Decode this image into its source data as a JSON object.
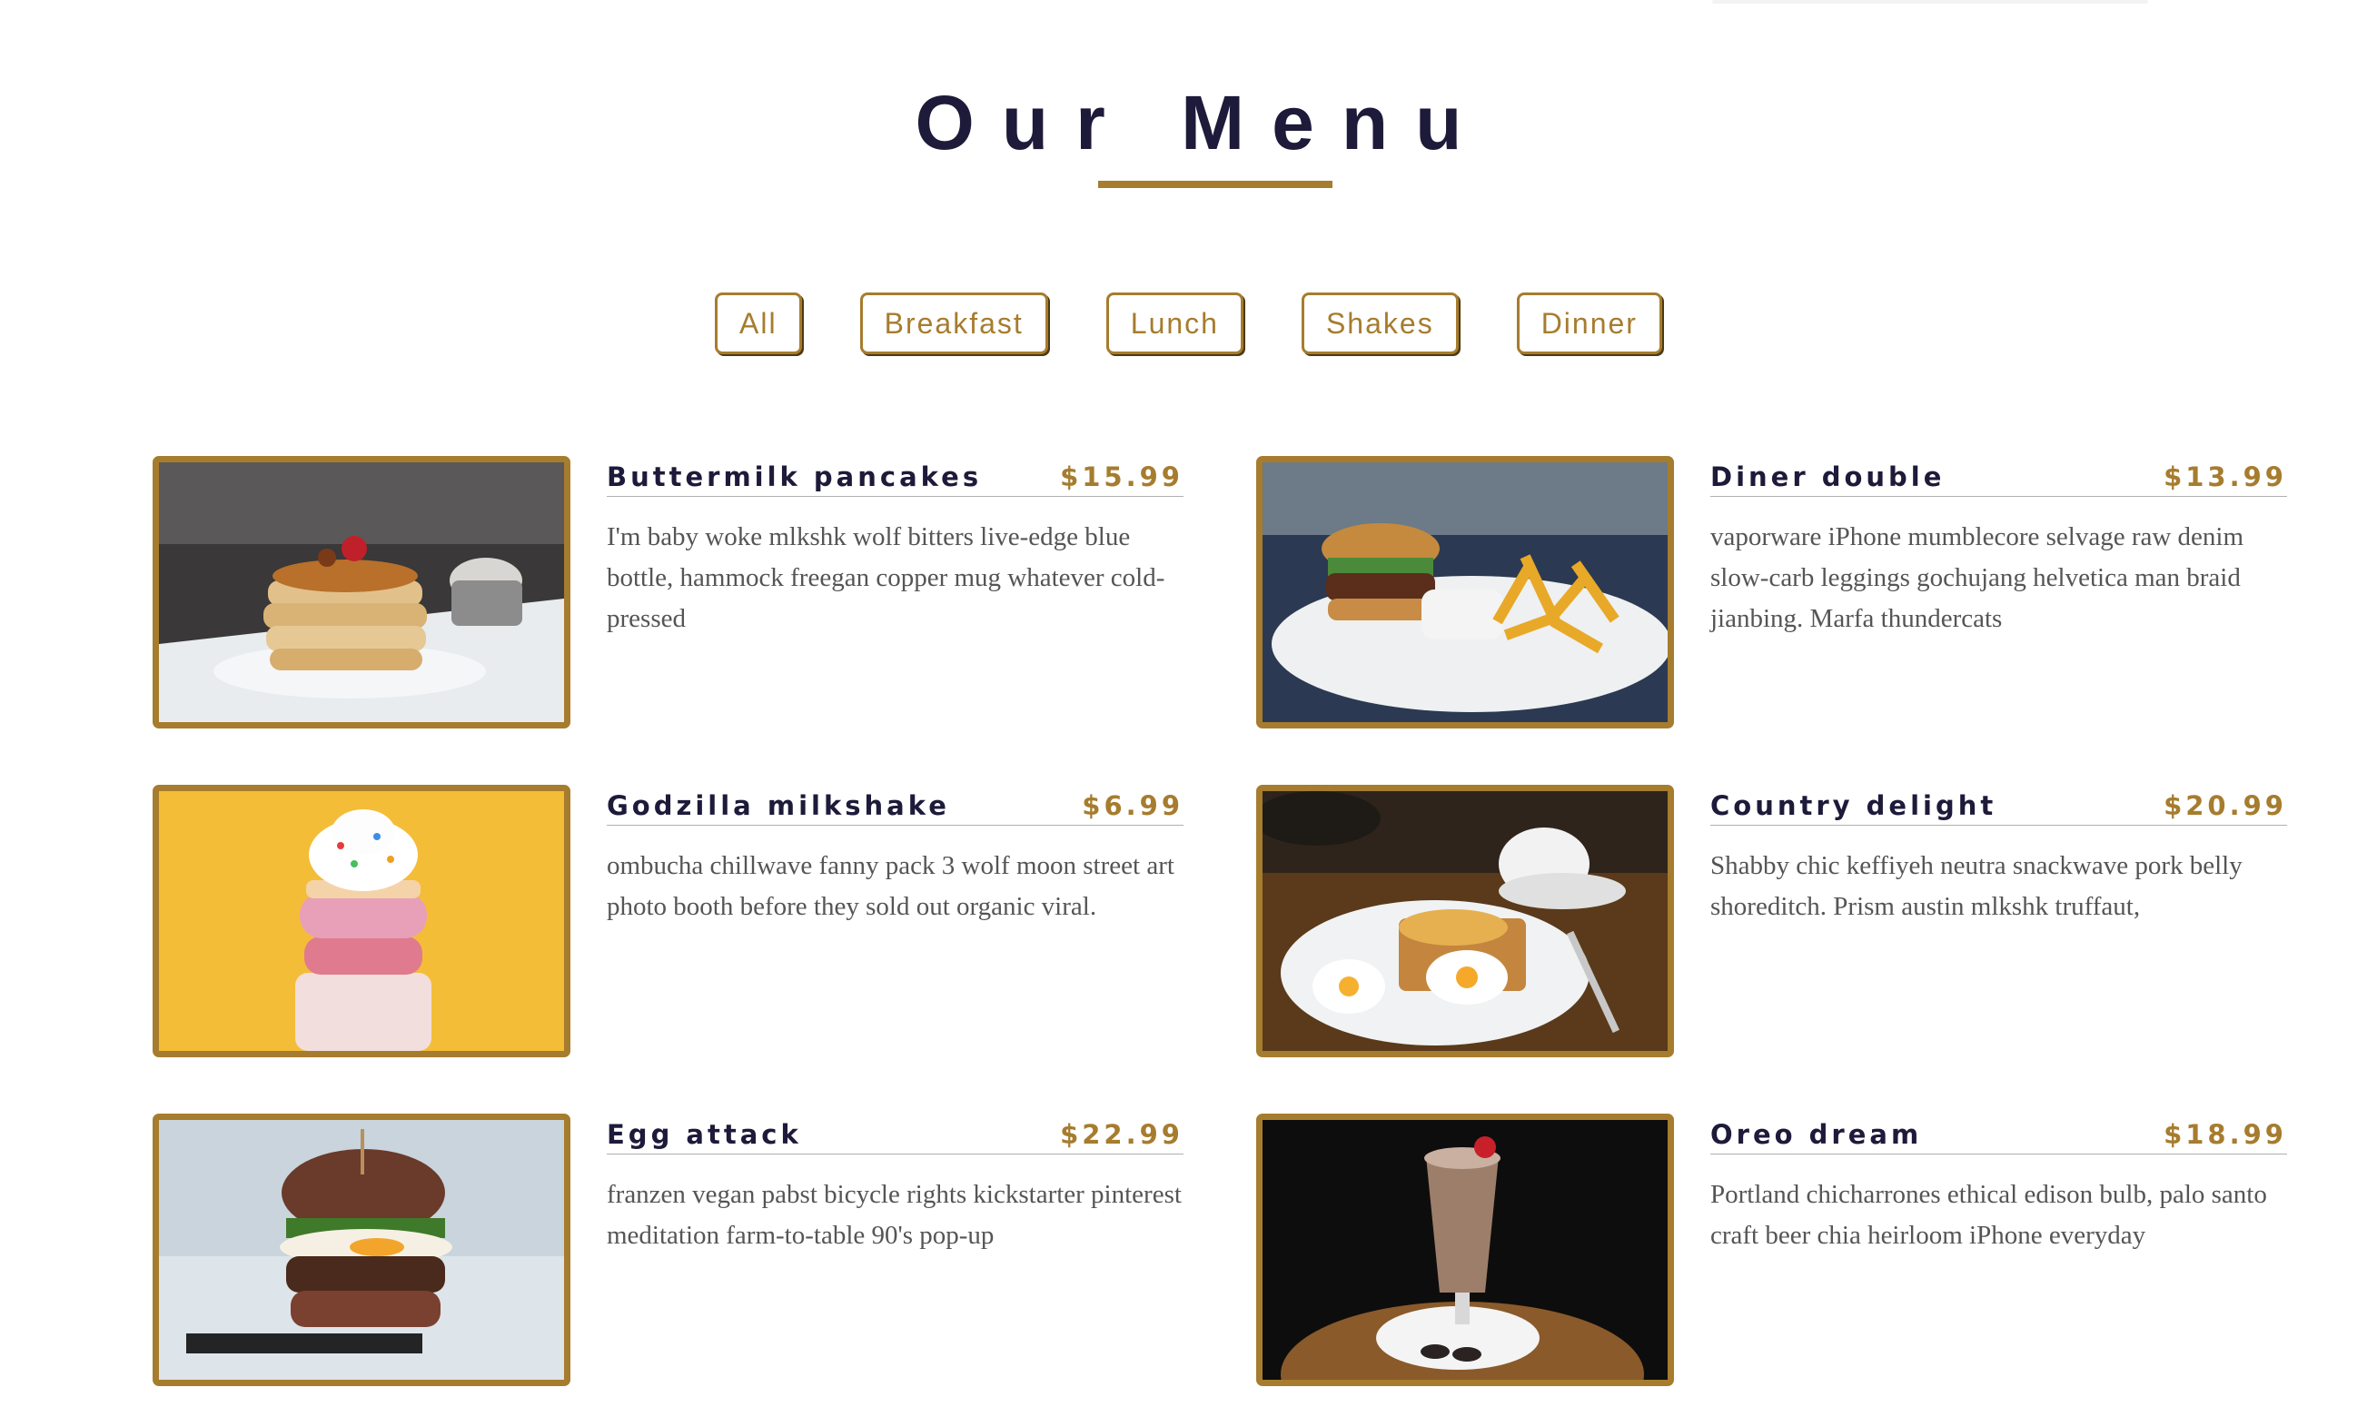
{
  "heading": "Our Menu",
  "filters": [
    "All",
    "Breakfast",
    "Lunch",
    "Shakes",
    "Dinner"
  ],
  "colors": {
    "accent": "#a67c2e",
    "heading": "#1d1a3a",
    "text": "#555555"
  },
  "items": [
    {
      "name": "Buttermilk pancakes",
      "price": "$15.99",
      "description": "I'm baby woke mlkshk wolf bitters live-edge blue bottle, hammock freegan copper mug whatever cold-pressed"
    },
    {
      "name": "Diner double",
      "price": "$13.99",
      "description": "vaporware iPhone mumblecore selvage raw denim slow-carb leggings gochujang helvetica man braid jianbing. Marfa thundercats"
    },
    {
      "name": "Godzilla milkshake",
      "price": "$6.99",
      "description": "ombucha chillwave fanny pack 3 wolf moon street art photo booth before they sold out organic viral."
    },
    {
      "name": "Country delight",
      "price": "$20.99",
      "description": "Shabby chic keffiyeh neutra snackwave pork belly shoreditch. Prism austin mlkshk truffaut,"
    },
    {
      "name": "Egg attack",
      "price": "$22.99",
      "description": "franzen vegan pabst bicycle rights kickstarter pinterest meditation farm-to-table 90's pop-up"
    },
    {
      "name": "Oreo dream",
      "price": "$18.99",
      "description": "Portland chicharrones ethical edison bulb, palo santo craft beer chia heirloom iPhone everyday"
    }
  ]
}
